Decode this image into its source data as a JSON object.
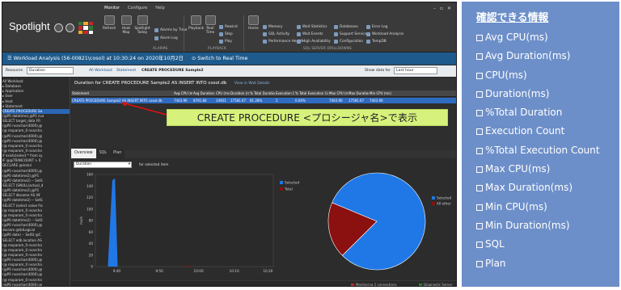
{
  "app": {
    "title": "Spotlight",
    "menu_tabs": [
      "Monitor",
      "Configure",
      "Help"
    ],
    "window_controls": [
      "–",
      "▫",
      "✕"
    ]
  },
  "ribbon": {
    "buttons": [
      {
        "label": "Refresh"
      },
      {
        "label": "Heat Map"
      },
      {
        "label": "Spotlight Today"
      },
      {
        "label": "Playback"
      },
      {
        "label": "Real Time"
      },
      {
        "label": "Home"
      }
    ],
    "alarm_items": [
      "Alarms by Time",
      "Alarm Log"
    ],
    "playback_items": [
      "Rewind",
      "Step",
      "Play"
    ],
    "home_items": [
      "Memory",
      "SQL Activity",
      "Performance Health"
    ],
    "drill_items": [
      "Wait Statistics",
      "Wait Events",
      "High Availability",
      "Databases",
      "Support Services",
      "Configuration",
      "Error Log",
      "Workload Analysis",
      "TempDB"
    ],
    "groups": [
      "ALARMS",
      "PLAYBACK",
      "SQL SERVER DRILLDOWNS"
    ]
  },
  "titlebar": {
    "text": "Workload Analysis (56-00821\\cosol) at 10:30:24 on 2020年10月2日",
    "realtime": "Switch to Real Time"
  },
  "resource_bar": {
    "resource_label": "Resource",
    "resource_value": "Duration",
    "breadcrumb": [
      "All Workload",
      "Statement",
      "CREATE PROCEDURE Sample2"
    ],
    "show_data_label": "Show data for",
    "show_data_value": "Last hour"
  },
  "tree": [
    "All Workload",
    "▸ Database",
    "▸ Application",
    "▸ User",
    "▸ Host",
    "▾ Statement",
    "  CREATE PROCEDURE Sa",
    "  (@P0 datetime),@P1 nva",
    "  SELECT target_data  FR",
    "  (@P0 nvarchar(4000),@",
    "  (@ msparam_0 nvarcha",
    "  (@P0 nvarchar(4000),@",
    "  (@P0 nvarchar(4000),@",
    "  (@ msparam_0 nvarcha",
    "  (@ msparam_0 nvarcha",
    "  if exists(select * from sy",
    "  IF @@TRANCOUNT > 0",
    "       DECLARE @instul",
    "  (@P0 nvarchar(4000),@",
    "  (@P0 datetime2),@P1",
    "  (@P0 datetime2) -- SetS",
    "  SELECT (SNULL(actual_d",
    "  (@P0 datetime2),@P1",
    "  SELECT dbname AS (N'",
    "  (@P0 datetime2) -- SetS",
    "  SELECT (select value fro",
    "  (@ msparam_0 nvarcha",
    "  (@ msparam_0 nvarcha",
    "  (@P0 datetime2) -- SetS",
    "  (@P0 nvarchar(4000),@",
    "       declare @tblLogical",
    "  (@P0 date) -- SetSt @C",
    "  SELECT edb.location AS",
    "  (@ msparam_0 nvarcha",
    "  (@ msparam_0 nvarcha",
    "  (@ msparam_0 nvarcha",
    "  (@P0 nvarchar(4000),@",
    "  (@ msparam_0 nvarcha",
    "  (@P0 nvarchar(4000),@",
    "  (@P0 nvarchar(4000),@",
    "  (@ msparam_0 nvarcha",
    "  (@P0 nvarchar(4000),@"
  ],
  "detail": {
    "title": "Duration for CREATE PROCEDURE Sample2 AS    INSERT INTO cosol.db",
    "view_link": "View in Wait Details",
    "columns": [
      "Statement",
      "Avg CPU (ms)",
      "Avg Duration (ms)",
      "CPU (ms)",
      "Duration (ms)",
      "% Total Duration",
      "Execution Count",
      "% Total Execution Count",
      "Max CPU (ms)",
      "Max Duration (ms)",
      "Min CPU (ms)"
    ],
    "row": [
      "CREATE PROCEDURE Sample2 AS    INSERT INTO cosol.db",
      "7463.90",
      "8791.84",
      "14921",
      "17581.67",
      "81.28%",
      "2",
      "0.04%",
      "7463.90",
      "17581.67",
      "7463.90"
    ]
  },
  "callout": "CREATE PROCEDURE <プロシージャ名>で表示",
  "tabs": [
    "Overview",
    "SQL",
    "Plan"
  ],
  "chart_controls": {
    "select_value": "Duration",
    "for_label": "for selected item"
  },
  "status_bar": [
    "Monitoring 2 connections",
    "Diagnostic Server"
  ],
  "info_panel": {
    "title": "確認できる情報",
    "items": [
      "Avg CPU(ms)",
      "Avg Duration(ms)",
      "CPU(ms)",
      "Duration(ms)",
      "%Total Duration",
      "Execution Count",
      "%Total Execution Count",
      "Max CPU(ms)",
      "Max Duration(ms)",
      "Min CPU(ms)",
      "Min Duration(ms)",
      "SQL",
      "Plan"
    ]
  },
  "chart_data": [
    {
      "type": "area",
      "ylabel": "ms/s",
      "ylim": [
        0,
        160
      ],
      "yticks": [
        0,
        20,
        40,
        60,
        80,
        100,
        120,
        140,
        160
      ],
      "xticks": [
        "9:40",
        "9:50",
        "10:00",
        "10:10",
        "10:20"
      ],
      "legend": [
        "Selected",
        "Total"
      ],
      "legend_placement": "right",
      "colors": {
        "Selected": "#1f78e6",
        "Total": "#8b1010"
      },
      "series": [
        {
          "name": "Selected",
          "points": [
            [
              0,
              0
            ],
            [
              0.07,
              0
            ],
            [
              0.095,
              150
            ],
            [
              0.11,
              153
            ],
            [
              0.125,
              0
            ],
            [
              1,
              0
            ]
          ]
        },
        {
          "name": "Total",
          "points": [
            [
              0,
              0
            ],
            [
              0.07,
              0
            ],
            [
              0.095,
              150
            ],
            [
              0.11,
              153
            ],
            [
              0.125,
              0
            ],
            [
              0.5,
              0
            ],
            [
              0.52,
              2
            ],
            [
              0.54,
              0
            ],
            [
              1,
              0
            ]
          ]
        }
      ],
      "grid": false
    },
    {
      "type": "pie",
      "labels": [
        "Selected",
        "All other"
      ],
      "values": [
        81.28,
        18.72
      ],
      "colors": [
        "#1f78e6",
        "#8b1010"
      ],
      "legend_placement": "right"
    }
  ]
}
